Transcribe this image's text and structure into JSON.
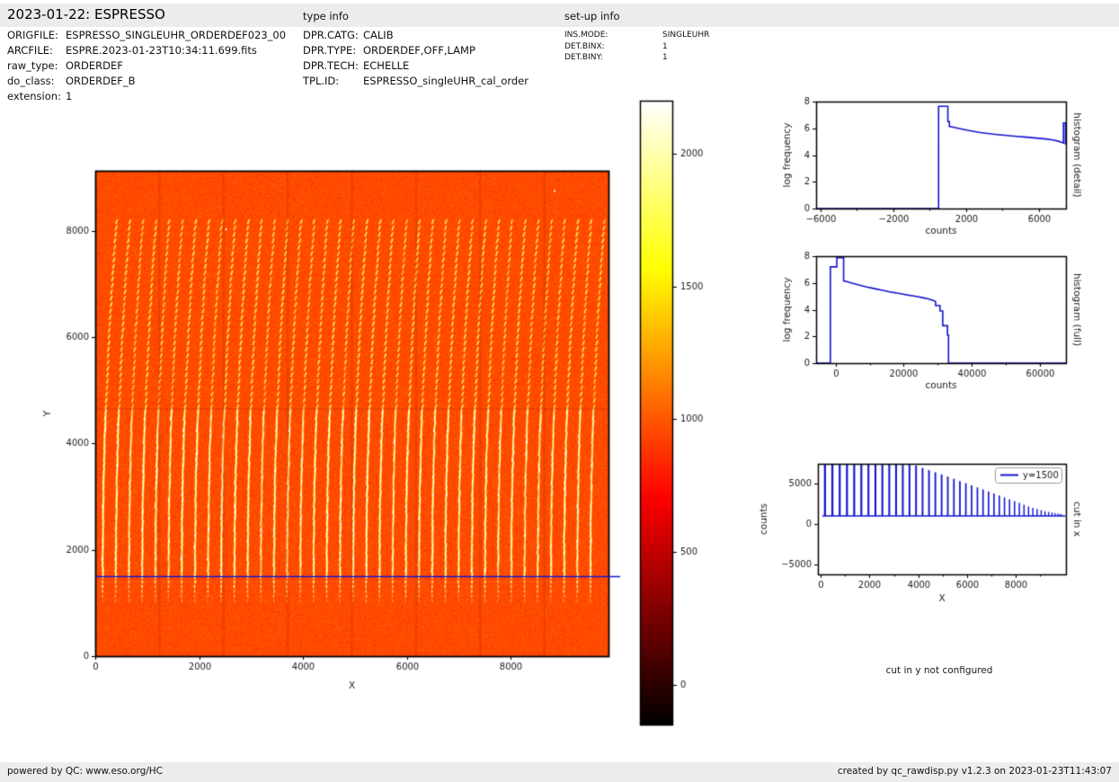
{
  "header": {
    "title": "2023-01-22: ESPRESSO",
    "type_info_label": "type info",
    "setup_info_label": "set-up info"
  },
  "file_info": {
    "rows": [
      {
        "label": "ORIGFILE:",
        "value": "ESPRESSO_SINGLEUHR_ORDERDEF023_00"
      },
      {
        "label": "ARCFILE:",
        "value": "ESPRE.2023-01-23T10:34:11.699.fits"
      },
      {
        "label": "raw_type:",
        "value": "ORDERDEF"
      },
      {
        "label": "do_class:",
        "value": "ORDERDEF_B"
      },
      {
        "label": "extension:",
        "value": "1"
      }
    ]
  },
  "type_info": {
    "rows": [
      {
        "label": "DPR.CATG:",
        "value": "CALIB"
      },
      {
        "label": "DPR.TYPE:",
        "value": "ORDERDEF,OFF,LAMP"
      },
      {
        "label": "DPR.TECH:",
        "value": "ECHELLE"
      },
      {
        "label": "TPL.ID:",
        "value": "ESPRESSO_singleUHR_cal_order"
      }
    ]
  },
  "setup_info": {
    "rows": [
      {
        "label": "INS.MODE:",
        "value": "SINGLEUHR"
      },
      {
        "label": "DET.BINX:",
        "value": "1"
      },
      {
        "label": "DET.BINY:",
        "value": "1"
      }
    ]
  },
  "notes": {
    "cut_in_y": "cut in y not configured"
  },
  "footer": {
    "left": "powered by QC: www.eso.org/HC",
    "right": "created by qc_rawdisp.py v1.2.3 on 2023-01-23T11:43:07"
  },
  "colors": {
    "line_blue": "#1515d0",
    "strip_bg": "#ececec",
    "frame": "#000000",
    "background_orange": "#fd5000"
  },
  "chart_data": [
    {
      "id": "raw-image",
      "type": "heatmap",
      "xlabel": "X",
      "ylabel": "Y",
      "xlim": [
        0,
        9887
      ],
      "ylim": [
        0,
        9130
      ],
      "xticks": [
        0,
        2000,
        4000,
        6000,
        8000
      ],
      "yticks": [
        0,
        2000,
        4000,
        6000,
        8000
      ],
      "colormap": "hot",
      "vmin": -150,
      "vmax": 2200,
      "background_level": 960,
      "cut_line_y": 1500,
      "orders": {
        "count": 38,
        "first_x": 140,
        "spacing": 254,
        "y_bottom": 1020,
        "y_fade": 1400,
        "y_split": 4650,
        "y_top": 8200,
        "curve_shift": 260
      },
      "seams_x": [
        1236,
        2472,
        3708,
        4944,
        6180,
        7416,
        8652
      ],
      "seam_y": 4650,
      "hot_pixels": [
        [
          8850,
          8750
        ],
        [
          2520,
          8030
        ]
      ]
    },
    {
      "id": "colorbar",
      "type": "colorbar",
      "colormap": "hot",
      "vmin": -150,
      "vmax": 2200,
      "ticks": [
        0,
        500,
        1000,
        1500,
        2000
      ]
    },
    {
      "id": "histogram-detail",
      "type": "step-line",
      "xlabel": "counts",
      "ylabel": "log frequency",
      "right_label": "histogram (detail)",
      "xlim": [
        -6250,
        7500
      ],
      "ylim": [
        0,
        8
      ],
      "xticks": [
        -6000,
        -2000,
        2000,
        6000
      ],
      "minor_xticks": [
        -4000,
        0,
        4000
      ],
      "yticks": [
        0,
        2,
        4,
        6,
        8
      ],
      "points": [
        [
          -6250,
          0
        ],
        [
          490,
          0
        ],
        [
          490,
          7.65
        ],
        [
          1000,
          7.65
        ],
        [
          1000,
          6.5
        ],
        [
          1080,
          6.5
        ],
        [
          1080,
          6.15
        ],
        [
          1400,
          6.05
        ],
        [
          1750,
          5.95
        ],
        [
          2100,
          5.85
        ],
        [
          2450,
          5.76
        ],
        [
          2800,
          5.68
        ],
        [
          3200,
          5.61
        ],
        [
          3600,
          5.55
        ],
        [
          4000,
          5.5
        ],
        [
          4400,
          5.45
        ],
        [
          4800,
          5.4
        ],
        [
          5200,
          5.35
        ],
        [
          5600,
          5.3
        ],
        [
          6000,
          5.25
        ],
        [
          6400,
          5.2
        ],
        [
          6800,
          5.13
        ],
        [
          7050,
          5.05
        ],
        [
          7250,
          4.95
        ],
        [
          7360,
          4.9
        ],
        [
          7360,
          6.4
        ],
        [
          7470,
          6.4
        ],
        [
          7470,
          4.85
        ],
        [
          7500,
          4.85
        ]
      ]
    },
    {
      "id": "histogram-full",
      "type": "step-line",
      "xlabel": "counts",
      "ylabel": "log frequency",
      "right_label": "histogram (full)",
      "xlim": [
        -5800,
        67800
      ],
      "ylim": [
        0,
        8
      ],
      "xticks": [
        0,
        20000,
        40000,
        60000
      ],
      "minor_xticks": [
        10000,
        30000,
        50000
      ],
      "yticks": [
        0,
        2,
        4,
        6,
        8
      ],
      "points": [
        [
          -5800,
          0
        ],
        [
          -1600,
          0
        ],
        [
          -1600,
          7.2
        ],
        [
          300,
          7.2
        ],
        [
          300,
          7.88
        ],
        [
          2300,
          7.88
        ],
        [
          2300,
          6.15
        ],
        [
          3500,
          6.08
        ],
        [
          4500,
          6.0
        ],
        [
          6000,
          5.9
        ],
        [
          7500,
          5.8
        ],
        [
          9000,
          5.7
        ],
        [
          10500,
          5.62
        ],
        [
          12000,
          5.54
        ],
        [
          13500,
          5.46
        ],
        [
          15000,
          5.38
        ],
        [
          16500,
          5.3
        ],
        [
          18000,
          5.24
        ],
        [
          19500,
          5.18
        ],
        [
          21000,
          5.1
        ],
        [
          22500,
          5.04
        ],
        [
          24000,
          4.97
        ],
        [
          25500,
          4.9
        ],
        [
          27000,
          4.82
        ],
        [
          28500,
          4.7
        ],
        [
          29400,
          4.6
        ],
        [
          29400,
          4.3
        ],
        [
          30700,
          4.3
        ],
        [
          30700,
          3.9
        ],
        [
          31500,
          3.9
        ],
        [
          31500,
          2.8
        ],
        [
          32900,
          2.8
        ],
        [
          32900,
          2.1
        ],
        [
          33200,
          2.1
        ],
        [
          33200,
          0
        ],
        [
          67800,
          0
        ]
      ]
    },
    {
      "id": "cut-in-x",
      "type": "spikes",
      "xlabel": "X",
      "ylabel": "counts",
      "right_label": "cut in x",
      "legend_label": "y=1500",
      "xlim": [
        -120,
        10060
      ],
      "ylim": [
        -6220,
        7450
      ],
      "xticks": [
        0,
        2000,
        4000,
        6000,
        8000
      ],
      "minor_xticks": [
        1000,
        3000,
        5000,
        7000,
        9000
      ],
      "yticks": [
        -5000,
        0,
        5000
      ],
      "baseline": 1000,
      "spikes": {
        "count": 44,
        "x_start": 170,
        "x_end": 9880,
        "gamma": 1.35
      },
      "envelope": [
        [
          0,
          7600
        ],
        [
          3600,
          7600
        ],
        [
          4200,
          6900
        ],
        [
          5000,
          6100
        ],
        [
          6000,
          5000
        ],
        [
          7000,
          3900
        ],
        [
          7800,
          3000
        ],
        [
          8600,
          2100
        ],
        [
          9200,
          1600
        ],
        [
          9900,
          1200
        ]
      ]
    }
  ]
}
